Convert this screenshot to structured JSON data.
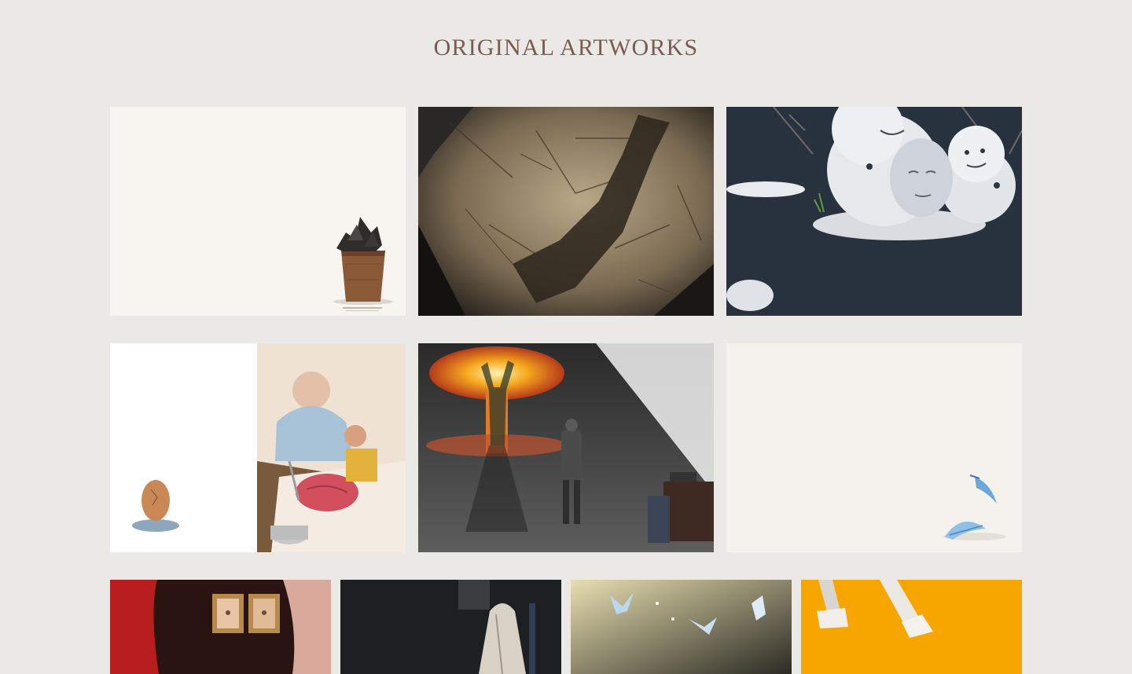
{
  "header": {
    "title": "ORIGINAL ARTWORKS"
  },
  "colors": {
    "background": "#ebe9e5",
    "title": "#7a5b52",
    "accent_orange": "#f7a600"
  },
  "gallery": {
    "items": [
      {
        "name": "artwork-bucket-stones"
      },
      {
        "name": "artwork-cracked-wall-shadow"
      },
      {
        "name": "artwork-snowmen-face"
      },
      {
        "name": "artwork-egg-butcher"
      },
      {
        "name": "artwork-explosion-shadow"
      },
      {
        "name": "artwork-blue-feathers"
      },
      {
        "name": "artwork-red-curtain-portraits"
      },
      {
        "name": "artwork-dark-veiled-figure"
      },
      {
        "name": "artwork-birds-light"
      },
      {
        "name": "artwork-orange-legs"
      }
    ]
  }
}
